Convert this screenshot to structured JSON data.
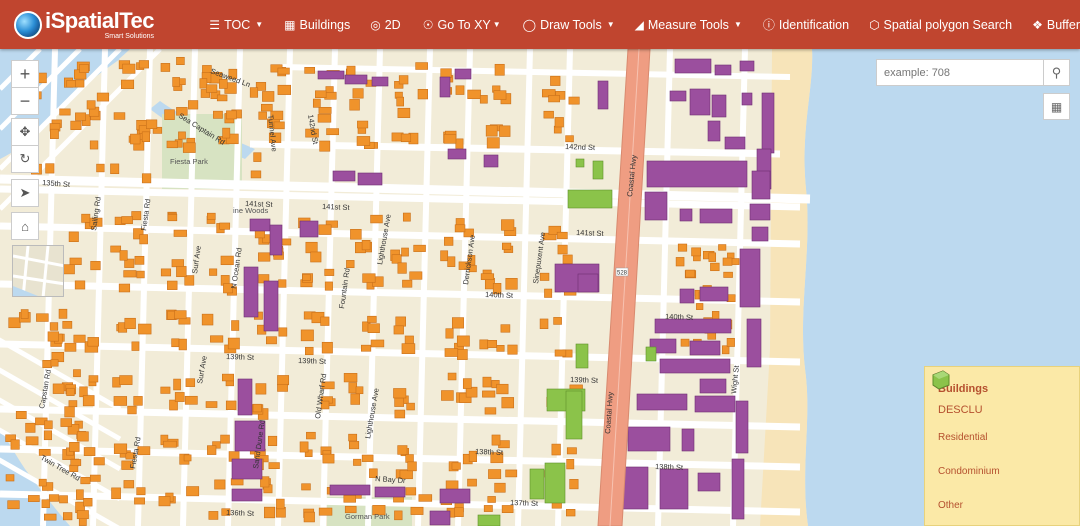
{
  "header": {
    "brand_name": "iSpatialTec",
    "brand_tagline": "Smart Solutions",
    "nav": [
      {
        "label": "TOC",
        "icon": "layers-icon",
        "dropdown": true
      },
      {
        "label": "Buildings",
        "icon": "table-icon",
        "dropdown": false
      },
      {
        "label": "2D",
        "icon": "globe-icon",
        "dropdown": false
      },
      {
        "label": "Go To XY",
        "icon": "map-pin-icon",
        "dropdown": true
      },
      {
        "label": "Draw Tools",
        "icon": "pencil-icon",
        "dropdown": true
      },
      {
        "label": "Measure Tools",
        "icon": "chart-icon",
        "dropdown": true
      },
      {
        "label": "Identification",
        "icon": "info-icon",
        "dropdown": false
      },
      {
        "label": "Spatial polygon Search",
        "icon": "polygon-icon",
        "dropdown": false
      },
      {
        "label": "Buffer",
        "icon": "buffer-icon",
        "dropdown": false
      }
    ]
  },
  "search": {
    "placeholder": "example: 708"
  },
  "legend": {
    "title": "Buildings",
    "field": "DESCLU",
    "classes": [
      {
        "label": "Residential",
        "color": "#f0932b"
      },
      {
        "label": "Condominium",
        "color": "#9b4f9e"
      },
      {
        "label": "Other",
        "color": "#8bc34a"
      }
    ]
  },
  "map": {
    "colors": {
      "land": "#f2ecd8",
      "block": "#f5efdb",
      "road": "#ffffff",
      "highway": "#ef9d82",
      "water": "#bcd9ef",
      "beach": "#f7e4b9",
      "park": "#d7e3c2",
      "header": "#c0452f"
    },
    "street_labels": [
      "Seaweed Ln",
      "Sea Captain Rd",
      "Tunnel Ave",
      "142nd St",
      "141st St",
      "Lighthouse Ave",
      "Derrickson Ave",
      "Sinepuxent Ave",
      "Coastal Hwy",
      "140th St",
      "139th St",
      "138th St",
      "137th St",
      "136th St",
      "135th St",
      "Sailing Rd",
      "Fiesta Rd",
      "Surf Ave",
      "Capstan Rd",
      "Twin Tree Rd",
      "N Ocean Rd",
      "Fountain Rd",
      "N Bay Dr",
      "Wight St",
      "Sand Dune Rd",
      "Old Wharf Rd",
      "Lighthouse Ave",
      "528"
    ],
    "place_labels": [
      "Fiesta Park",
      "ine Woods",
      "Gorman Park"
    ]
  }
}
